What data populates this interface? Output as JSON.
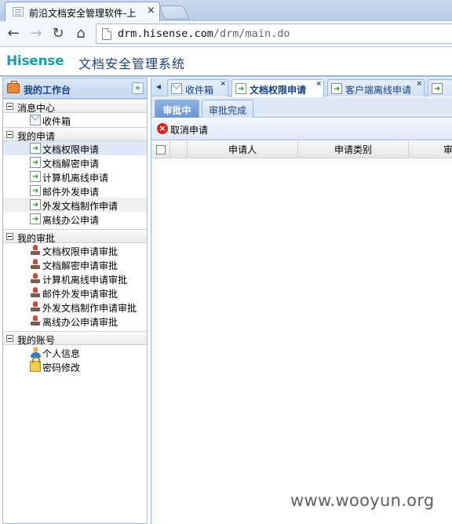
{
  "browser": {
    "tab_title": "前沿文档安全管理软件-上",
    "tab_close": "×",
    "url_host": "drm.hisense.com",
    "url_path": "/drm/main.do",
    "nav": {
      "back": "←",
      "forward": "→",
      "reload": "↻",
      "home": "⌂"
    }
  },
  "app": {
    "logo": "Hisense",
    "title": "文档安全管理系统",
    "colors": {
      "logo": "#1e9bb0",
      "header_text": "#15428b",
      "panel_border": "#99bbe8"
    }
  },
  "sidebar": {
    "title": "我的工作台",
    "collapse": "«",
    "groups": [
      {
        "label": "消息中心",
        "items": [
          {
            "label": "收件箱",
            "icon": "mail-icon"
          }
        ]
      },
      {
        "label": "我的申请",
        "items": [
          {
            "label": "文档权限申请",
            "icon": "doc-arrow-icon"
          },
          {
            "label": "文档解密申请",
            "icon": "doc-arrow-icon"
          },
          {
            "label": "计算机离线申请",
            "icon": "doc-arrow-icon"
          },
          {
            "label": "邮件外发申请",
            "icon": "doc-arrow-icon"
          },
          {
            "label": "外发文档制作申请",
            "icon": "doc-arrow-icon"
          },
          {
            "label": "离线办公申请",
            "icon": "doc-arrow-icon"
          }
        ]
      },
      {
        "label": "我的审批",
        "items": [
          {
            "label": "文档权限申请审批",
            "icon": "stamp-icon"
          },
          {
            "label": "文档解密申请审批",
            "icon": "stamp-icon"
          },
          {
            "label": "计算机离线申请审批",
            "icon": "stamp-icon"
          },
          {
            "label": "邮件外发申请审批",
            "icon": "stamp-icon"
          },
          {
            "label": "外发文档制作申请审批",
            "icon": "stamp-icon"
          },
          {
            "label": "离线办公申请审批",
            "icon": "stamp-icon"
          }
        ]
      },
      {
        "label": "我的账号",
        "items": [
          {
            "label": "个人信息",
            "icon": "person-icon"
          },
          {
            "label": "密码修改",
            "icon": "lock-icon"
          }
        ]
      }
    ]
  },
  "main": {
    "tabs": [
      {
        "label": "收件箱",
        "close": "×"
      },
      {
        "label": "文档权限申请",
        "close": "×"
      },
      {
        "label": "客户端离线申请",
        "close": "×"
      }
    ],
    "subtabs": [
      {
        "label": "审批中"
      },
      {
        "label": "审批完成"
      }
    ],
    "toolbar": {
      "cancel_label": "取消申请"
    },
    "grid": {
      "columns": [
        "申请人",
        "申请类别",
        "审"
      ]
    }
  },
  "watermark": "www.wooyun.org"
}
